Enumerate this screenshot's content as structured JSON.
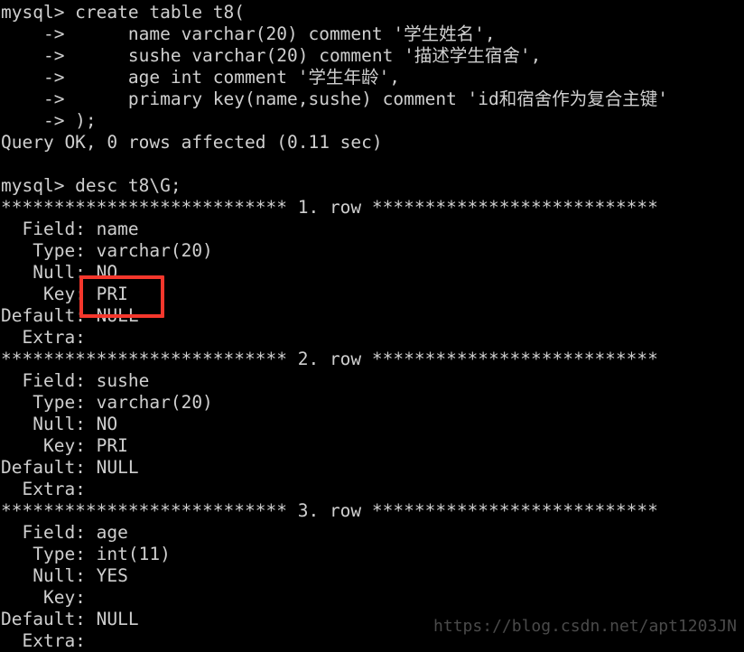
{
  "terminal": {
    "title": "mysql command line client",
    "prompt": "mysql>",
    "continuation_prompt": "->",
    "colors": {
      "background": "#000000",
      "foreground": "#cfcfcf",
      "annotation": "#f5372c",
      "watermark": "#4a4a4a"
    },
    "lines": [
      "mysql> create table t8(",
      "    ->      name varchar(20) comment '学生姓名',",
      "    ->      sushe varchar(20) comment '描述学生宿舍',",
      "    ->      age int comment '学生年龄',",
      "    ->      primary key(name,sushe) comment 'id和宿舍作为复合主键'",
      "    -> );",
      "Query OK, 0 rows affected (0.11 sec)",
      "",
      "mysql> desc t8\\G;",
      "*************************** 1. row ***************************",
      "  Field: name",
      "   Type: varchar(20)",
      "   Null: NO",
      "    Key: PRI",
      "Default: NULL",
      "  Extra: ",
      "*************************** 2. row ***************************",
      "  Field: sushe",
      "   Type: varchar(20)",
      "   Null: NO",
      "    Key: PRI",
      "Default: NULL",
      "  Extra: ",
      "*************************** 3. row ***************************",
      "  Field: age",
      "   Type: int(11)",
      "   Null: YES",
      "    Key: ",
      "Default: NULL",
      "  Extra: "
    ]
  },
  "statement": {
    "command": "create table t8",
    "table_name": "t8",
    "columns": [
      {
        "name": "name",
        "type": "varchar(20)",
        "comment": "学生姓名"
      },
      {
        "name": "sushe",
        "type": "varchar(20)",
        "comment": "描述学生宿舍"
      },
      {
        "name": "age",
        "type": "int",
        "comment": "学生年龄"
      }
    ],
    "primary_key": {
      "columns": "name,sushe",
      "comment": "id和宿舍作为复合主键"
    },
    "result": "Query OK, 0 rows affected (0.11 sec)",
    "rows_affected": "0",
    "duration": "0.11 sec"
  },
  "describe": {
    "command": "desc t8\\G;",
    "row_labels": [
      "Field",
      "Type",
      "Null",
      "Key",
      "Default",
      "Extra"
    ],
    "rows": [
      {
        "index": "1. row",
        "Field": "name",
        "Type": "varchar(20)",
        "Null": "NO",
        "Key": "PRI",
        "Default": "NULL",
        "Extra": ""
      },
      {
        "index": "2. row",
        "Field": "sushe",
        "Type": "varchar(20)",
        "Null": "NO",
        "Key": "PRI",
        "Default": "NULL",
        "Extra": ""
      },
      {
        "index": "3. row",
        "Field": "age",
        "Type": "int(11)",
        "Null": "YES",
        "Key": "",
        "Default": "NULL",
        "Extra": ""
      }
    ]
  },
  "annotation": {
    "shape": "rectangle",
    "color": "#f5372c",
    "highlights": "Key: PRI / Default: NULL of row 1"
  },
  "watermark": {
    "text": "https://blog.csdn.net/apt1203JN"
  }
}
